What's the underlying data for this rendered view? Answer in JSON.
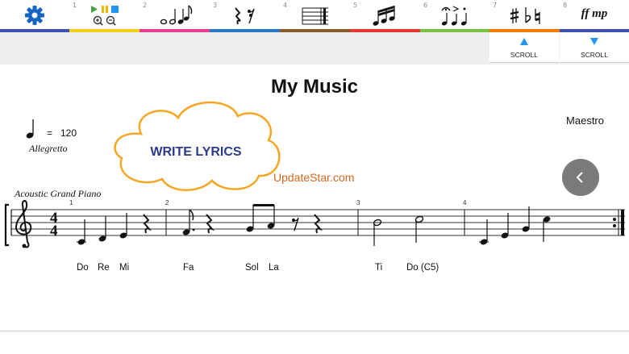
{
  "toolbar": {
    "tools": [
      {
        "name": "settings",
        "num": "",
        "color": "#3f51b5",
        "icon": "gear-icon"
      },
      {
        "name": "playback-zoom",
        "num": "1",
        "color": "#f4d01c",
        "icon": "playback-zoom-icon"
      },
      {
        "name": "notes",
        "num": "2",
        "color": "#e83e8c",
        "icon": "notes-icon"
      },
      {
        "name": "rests",
        "num": "3",
        "color": "#2979c9",
        "icon": "rests-icon"
      },
      {
        "name": "barlines",
        "num": "4",
        "color": "#8b5a2b",
        "icon": "barlines-icon"
      },
      {
        "name": "beamed-notes",
        "num": "5",
        "color": "#e53935",
        "icon": "beamed-notes-icon"
      },
      {
        "name": "articulations",
        "num": "6",
        "color": "#76c442",
        "icon": "articulations-icon"
      },
      {
        "name": "accidentals",
        "num": "7",
        "color": "#f57c00",
        "icon": "accidentals-icon"
      },
      {
        "name": "dynamics",
        "num": "8",
        "color": "#3f51b5",
        "icon": "dynamics-icon"
      }
    ],
    "dynamics_text": "ff mp"
  },
  "scroll": {
    "up_label": "SCROLL",
    "down_label": "SCROLL",
    "arrow_color": "#2196f3"
  },
  "score": {
    "title": "My Music",
    "composer": "Maestro",
    "tempo_eq": "=",
    "tempo_value": "120",
    "tempo_word": "Allegretto",
    "instrument": "Acoustic Grand Piano",
    "time_signature": {
      "top": "4",
      "bottom": "4"
    },
    "measure_numbers": [
      "1",
      "2",
      "3",
      "4"
    ],
    "lyrics": [
      "Do",
      "Re",
      "Mi",
      "Fa",
      "Sol",
      "La",
      "Ti",
      "Do (C5)"
    ]
  },
  "overlay": {
    "cloud_label": "WRITE LYRICS",
    "cloud_color": "#f5a623",
    "cloud_text_color": "#2a3a8c"
  },
  "watermark": "UpdateStar.com",
  "back_button": {
    "icon": "chevron-left-icon"
  }
}
